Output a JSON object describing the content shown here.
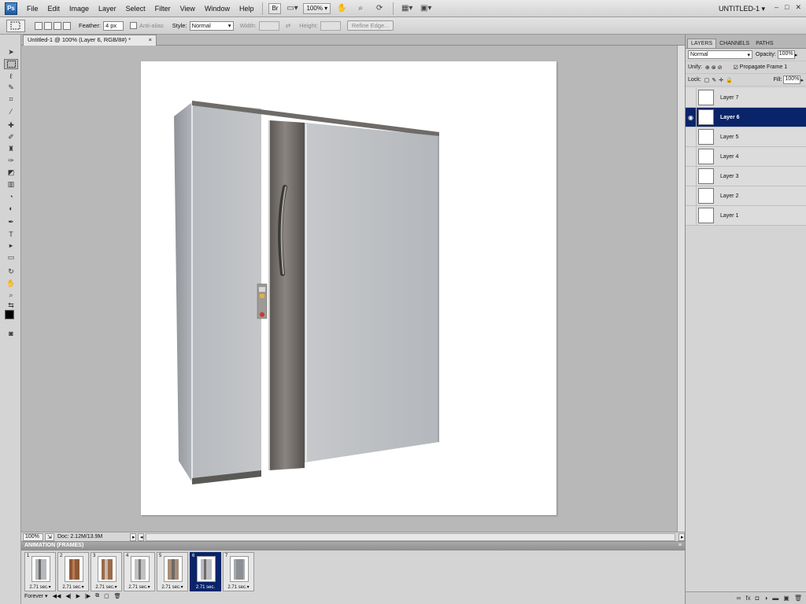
{
  "app": {
    "logo": "Ps",
    "document_title": "UNTITLED-1 ▾",
    "window_controls": [
      "–",
      "□",
      "✕"
    ]
  },
  "menu": [
    "File",
    "Edit",
    "Image",
    "Layer",
    "Select",
    "Filter",
    "View",
    "Window",
    "Help"
  ],
  "menubar_extras": {
    "bridge": "Br",
    "zoom": "100%"
  },
  "options": {
    "feather_label": "Feather:",
    "feather_value": "4 px",
    "antialias_label": "Anti-alias",
    "style_label": "Style:",
    "style_value": "Normal",
    "width_label": "Width:",
    "height_label": "Height:",
    "refine_label": "Refine Edge..."
  },
  "document_tab": {
    "title": "Untitled-1 @ 100% (Layer 6, RGB/8#) *",
    "close": "×"
  },
  "status": {
    "zoom": "100%",
    "doc_info": "Doc: 2.12M/13.9M"
  },
  "animation": {
    "title": "ANIMATION (FRAMES)",
    "frames": [
      {
        "num": "1",
        "delay": "2.71 sec.▾"
      },
      {
        "num": "2",
        "delay": "2.71 sec.▾"
      },
      {
        "num": "3",
        "delay": "2.71 sec.▾"
      },
      {
        "num": "4",
        "delay": "2.71 sec.▾"
      },
      {
        "num": "5",
        "delay": "2.71 sec.▾"
      },
      {
        "num": "6",
        "delay": "2.71 sec."
      },
      {
        "num": "7",
        "delay": "2.71 sec.▾"
      }
    ],
    "loop": "Forever ▾"
  },
  "layers_panel": {
    "tabs": [
      "LAYERS",
      "CHANNELS",
      "PATHS"
    ],
    "blend_mode": "Normal",
    "opacity_label": "Opacity:",
    "opacity_value": "100%",
    "unify_label": "Unify:",
    "propagate_label": "Propagate Frame 1",
    "lock_label": "Lock:",
    "fill_label": "Fill:",
    "fill_value": "100%",
    "layers": [
      {
        "name": "Layer 7",
        "visible": false,
        "selected": false
      },
      {
        "name": "Layer 6",
        "visible": true,
        "selected": true
      },
      {
        "name": "Layer 5",
        "visible": false,
        "selected": false
      },
      {
        "name": "Layer 4",
        "visible": false,
        "selected": false
      },
      {
        "name": "Layer 3",
        "visible": false,
        "selected": false
      },
      {
        "name": "Layer 2",
        "visible": false,
        "selected": false
      },
      {
        "name": "Layer 1",
        "visible": false,
        "selected": false
      }
    ]
  },
  "colors": {
    "selection": "#0a246a",
    "canvas_bg": "#b8b8b8",
    "door": "#b9bcc1",
    "handle_strip": "#6f6a66"
  }
}
